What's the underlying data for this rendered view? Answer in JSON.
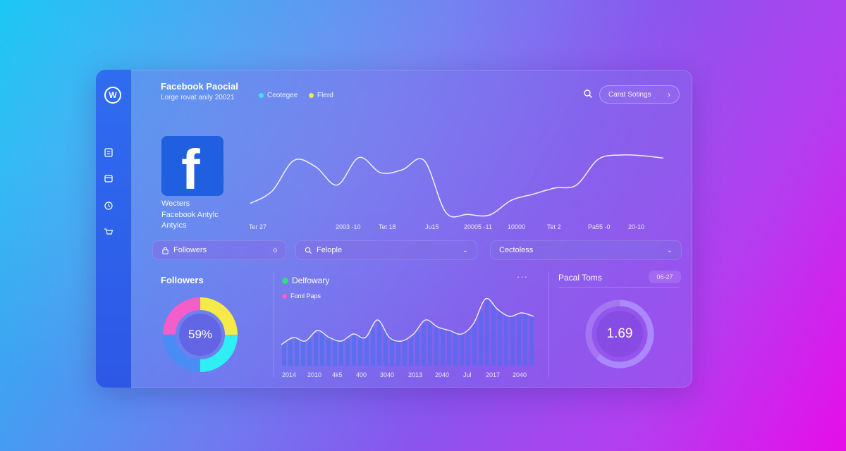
{
  "header": {
    "title": "Facebook Paocial",
    "subtitle": "Lorge rovat anily 20021",
    "legend": [
      {
        "label": "Ceotegee",
        "color": "#3ee0f2"
      },
      {
        "label": "Flerd",
        "color": "#f0e84a"
      }
    ],
    "settings_label": "Carat Sotings"
  },
  "brand": {
    "lines": [
      "Wecters",
      "Facebook Antylc",
      "Antyics"
    ]
  },
  "sidebar": {
    "logo_letter": "W",
    "icons": [
      "clipboard-icon",
      "calendar-icon",
      "clock-icon",
      "cart-icon"
    ]
  },
  "main_chart": {
    "x_ticks": [
      "Ter 27",
      "2003 -10",
      "Tet 18",
      "Ju15",
      "20005 -11",
      "10000",
      "Tet 2",
      "Pa55 -0",
      "20-10"
    ],
    "values": [
      2,
      4,
      9,
      8,
      5,
      9.5,
      7,
      7.5,
      9,
      0.5,
      0.2,
      0.1,
      2.5,
      3.5,
      4.5,
      5,
      9.2,
      9.9,
      9.8,
      9.4
    ]
  },
  "filters": {
    "followers": {
      "label": "Followers",
      "end": "o"
    },
    "people": {
      "label": "Felople"
    },
    "categories": {
      "label": "Cectoless"
    }
  },
  "followers_card": {
    "title": "Followers",
    "percent": "59%",
    "segments": [
      {
        "value": 25,
        "color": "#f6e94a"
      },
      {
        "value": 25,
        "color": "#2ef0f4"
      },
      {
        "value": 25,
        "color": "#4a8cf6"
      },
      {
        "value": 25,
        "color": "#f35ec8"
      }
    ]
  },
  "bar_card": {
    "legend": [
      {
        "label": "Delfowary",
        "color": "#2fe07a"
      },
      {
        "label": "Foml Paps",
        "color": "#f560c8"
      }
    ],
    "more": "···",
    "x_ticks": [
      "2014",
      "2010",
      "4k5",
      "400",
      "3040",
      "2013",
      "2040",
      "Jul",
      "2017",
      "2040"
    ],
    "values": [
      3,
      4,
      3.5,
      5,
      4,
      3.5,
      4.5,
      4,
      6.5,
      4,
      3.5,
      4.5,
      6.5,
      5.5,
      5,
      4.5,
      6,
      9.5,
      8,
      7,
      7.5,
      7
    ]
  },
  "ring_card": {
    "title": "Pacal Toms",
    "badge": "06-27",
    "value": "1.69",
    "fraction": 0.62
  },
  "colors": {
    "sidebar": "#2f6cf0",
    "facebook_blue": "#1f5fe0"
  }
}
